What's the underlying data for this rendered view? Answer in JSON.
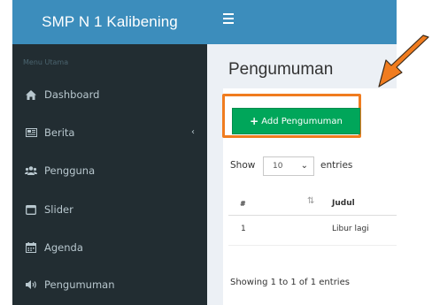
{
  "app": {
    "brand": "SMP N 1 Kalibening"
  },
  "sidebar": {
    "header": "Menu Utama",
    "items": [
      {
        "label": "Dashboard",
        "icon": "home-icon"
      },
      {
        "label": "Berita",
        "icon": "newspaper-icon",
        "has_children": true
      },
      {
        "label": "Pengguna",
        "icon": "users-icon"
      },
      {
        "label": "Slider",
        "icon": "window-icon"
      },
      {
        "label": "Agenda",
        "icon": "calendar-icon"
      },
      {
        "label": "Pengumuman",
        "icon": "volume-icon"
      }
    ]
  },
  "page": {
    "title": "Pengumuman"
  },
  "toolbar": {
    "add_label": "Add Pengumuman"
  },
  "table": {
    "show_label": "Show",
    "page_size": "10",
    "entries_label": "entries",
    "columns": [
      "#",
      "Judul"
    ],
    "rows": [
      {
        "num": "1",
        "judul": "Libur lagi"
      }
    ],
    "info": "Showing 1 to 1 of 1 entries"
  },
  "colors": {
    "header": "#3c8dbc",
    "sidebar": "#222d32",
    "add_button": "#00a65a",
    "highlight": "#f07c1f"
  }
}
